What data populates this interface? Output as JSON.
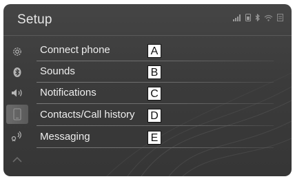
{
  "screen": {
    "title": "Setup"
  },
  "status_icons": [
    "signal-bars-icon",
    "phone-battery-icon",
    "bluetooth-icon",
    "wifi-icon",
    "data-icon"
  ],
  "sidebar": {
    "items": [
      {
        "icon": "gear-icon",
        "selected": false
      },
      {
        "icon": "bluetooth-icon",
        "selected": false
      },
      {
        "icon": "speaker-icon",
        "selected": false
      },
      {
        "icon": "phone-icon",
        "selected": true
      },
      {
        "icon": "voice-icon",
        "selected": false
      },
      {
        "icon": "other-icon",
        "selected": false
      }
    ]
  },
  "menu": {
    "items": [
      {
        "label": "Connect phone",
        "callout": "A"
      },
      {
        "label": "Sounds",
        "callout": "B"
      },
      {
        "label": "Notifications",
        "callout": "C"
      },
      {
        "label": "Contacts/Call history",
        "callout": "D"
      },
      {
        "label": "Messaging",
        "callout": "E"
      }
    ]
  },
  "colors": {
    "background": "#3c3c3c",
    "text": "#eeeeee",
    "callout_bg": "#ffffff",
    "callout_border": "#111111"
  }
}
